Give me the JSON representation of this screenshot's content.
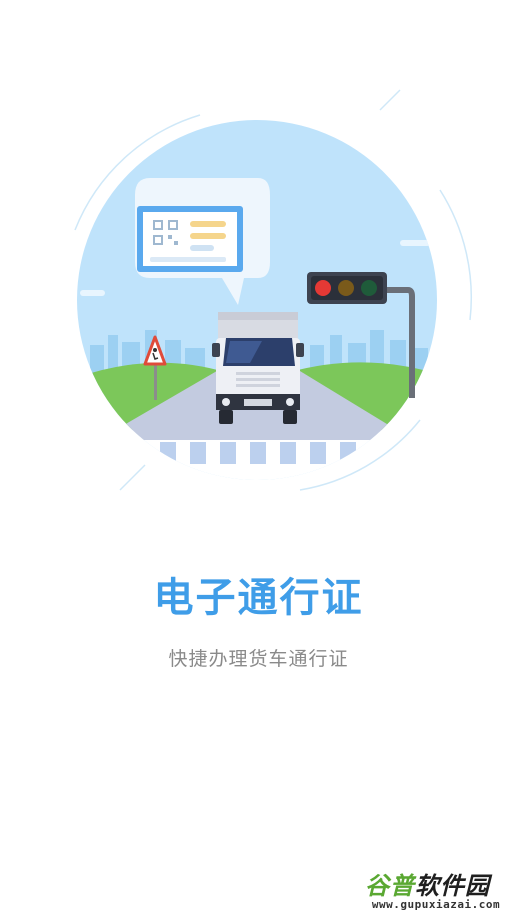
{
  "splash": {
    "title": "电子通行证",
    "subtitle": "快捷办理货车通行证",
    "title_color": "#3f9de8"
  },
  "illustration": {
    "traffic_light_colors": [
      "#e53935",
      "#7a5a1a",
      "#1f5b3a"
    ],
    "sky_color": "#bfe3fb",
    "grass_color": "#7cc75a",
    "road_color": "#c3cbe0"
  },
  "watermark": {
    "logo_part1": "谷普",
    "logo_part2": "软件园",
    "url": "www.gupuxiazai.com"
  }
}
